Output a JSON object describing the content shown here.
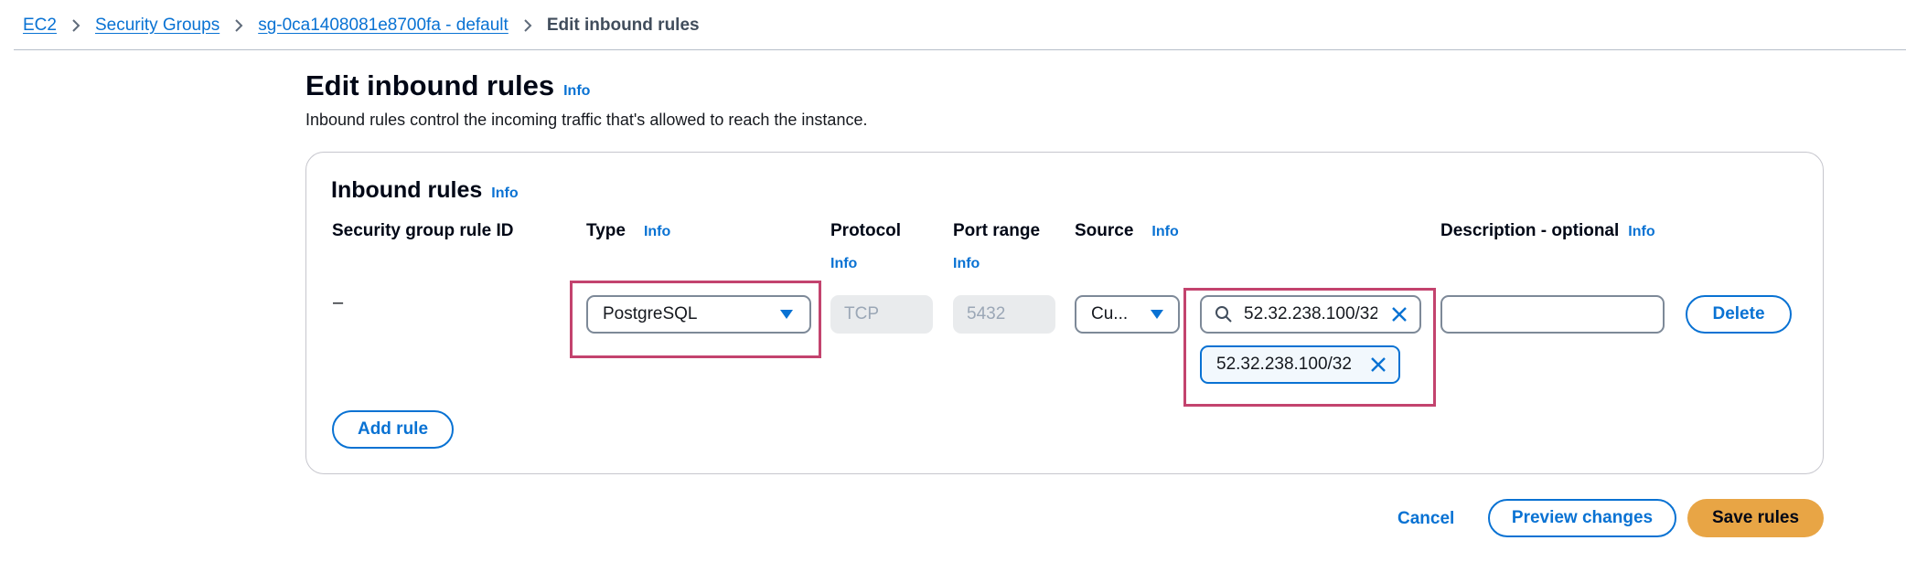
{
  "breadcrumb": {
    "items": [
      "EC2",
      "Security Groups",
      "sg-0ca1408081e8700fa - default"
    ],
    "current": "Edit inbound rules"
  },
  "page": {
    "title": "Edit inbound rules",
    "info": "Info",
    "description": "Inbound rules control the incoming traffic that's allowed to reach the instance."
  },
  "panel": {
    "title": "Inbound rules",
    "info": "Info",
    "columns": {
      "rule_id": "Security group rule ID",
      "type": "Type",
      "protocol": "Protocol",
      "port_range": "Port range",
      "source": "Source",
      "description": "Description - optional"
    },
    "info_label": "Info"
  },
  "rule": {
    "id": "–",
    "type": "PostgreSQL",
    "protocol": "TCP",
    "port_range": "5432",
    "source": "Cu...",
    "cidr_input_value": "52.32.238.100/32",
    "cidr_token": "52.32.238.100/32",
    "description_value": "",
    "delete_label": "Delete"
  },
  "actions": {
    "add_rule": "Add rule",
    "cancel": "Cancel",
    "preview": "Preview changes",
    "save": "Save rules"
  },
  "colors": {
    "link": "#0972d3",
    "primary_button": "#e8a545",
    "highlight_box": "#c3436e"
  }
}
